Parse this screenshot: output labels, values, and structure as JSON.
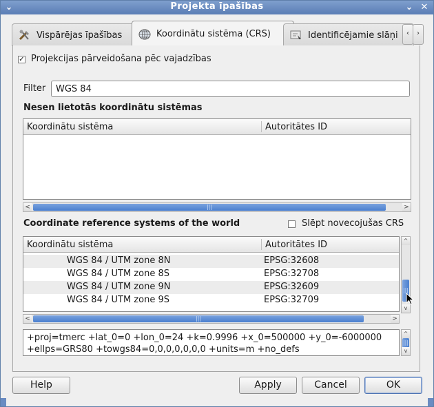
{
  "window": {
    "title": "Projekta īpašības",
    "menu_icon": "chevron-down-icon",
    "minimize_icon": "chevron-down-icon",
    "close_icon": "close-icon"
  },
  "tabs": [
    {
      "label": "Vispārējas īpašības",
      "icon": "tools-icon",
      "active": false
    },
    {
      "label": "Koordinātu sistēma (CRS)",
      "icon": "globe-icon",
      "active": true
    },
    {
      "label": "Identificējamie slāņi",
      "icon": "identify-icon",
      "active": false
    }
  ],
  "tab_scroll": {
    "left": "‹",
    "right": "›"
  },
  "reproject": {
    "label": "Projekcijas pārveidošana pēc vajadzības",
    "checked": true,
    "mark": "✓"
  },
  "filter": {
    "label": "Filter",
    "value": "WGS 84"
  },
  "recent": {
    "title": "Nesen lietotās koordinātu sistēmas",
    "col1": "Koordinātu sistēma",
    "col2": "Autoritātes ID"
  },
  "world": {
    "title": "Coordinate reference systems of the world",
    "hide_deprecated_label": "Slēpt novecojušas CRS",
    "hide_deprecated_checked": false,
    "col1": "Koordinātu sistēma",
    "col2": "Autoritātes ID",
    "rows": [
      {
        "name": "WGS 84 / UTM zone 8N",
        "auth": "EPSG:32608"
      },
      {
        "name": "WGS 84 / UTM zone 8S",
        "auth": "EPSG:32708"
      },
      {
        "name": "WGS 84 / UTM zone 9N",
        "auth": "EPSG:32609"
      },
      {
        "name": "WGS 84 / UTM zone 9S",
        "auth": "EPSG:32709"
      }
    ]
  },
  "proj_string": {
    "line1": "+proj=tmerc +lat_0=0 +lon_0=24 +k=0.9996 +x_0=500000 +y_0=-6000000",
    "line2": "+ellps=GRS80 +towgs84=0,0,0,0,0,0,0 +units=m +no_defs"
  },
  "scroll_glyphs": {
    "left": "<",
    "right": ">",
    "up": "^",
    "down": "v",
    "grip": "|||"
  },
  "buttons": {
    "help": "Help",
    "apply": "Apply",
    "cancel": "Cancel",
    "ok": "OK"
  },
  "colors": {
    "titlebar": "#6a8cc2",
    "scroll_thumb": "#5a8ad4",
    "selection_row": "#ececec"
  }
}
